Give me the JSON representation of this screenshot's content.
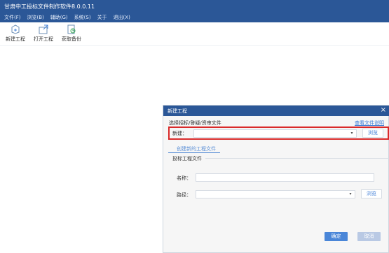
{
  "window": {
    "title": "甘肃中工投标文件制作软件8.0.0.11"
  },
  "menu": {
    "items": [
      "文件(F)",
      "浏览(B)",
      "辅助(G)",
      "系统(S)",
      "关于",
      "退出(X)"
    ]
  },
  "toolbar": {
    "buttons": [
      {
        "label": "新建工程",
        "icon": "new-project-icon"
      },
      {
        "label": "打开工程",
        "icon": "open-project-icon"
      },
      {
        "label": "获取备份",
        "icon": "get-backup-icon"
      }
    ]
  },
  "dialog": {
    "title": "新建工程",
    "close": "×",
    "choose_label": "选择招标/答疑/资审文件",
    "help_link": "查看文件说明",
    "new_label": "新建：",
    "new_value": "",
    "browse_label": "浏览",
    "tab_label": "创建新的工程文件",
    "group_title": "投标工程文件",
    "name_label": "名称：",
    "name_value": "",
    "path_label": "路径：",
    "path_value": "",
    "path_browse_label": "浏览",
    "ok_label": "确定",
    "cancel_label": "取消",
    "colors": {
      "accent": "#2b5797",
      "highlight": "#d92a2a",
      "link": "#3b7bd6"
    }
  }
}
